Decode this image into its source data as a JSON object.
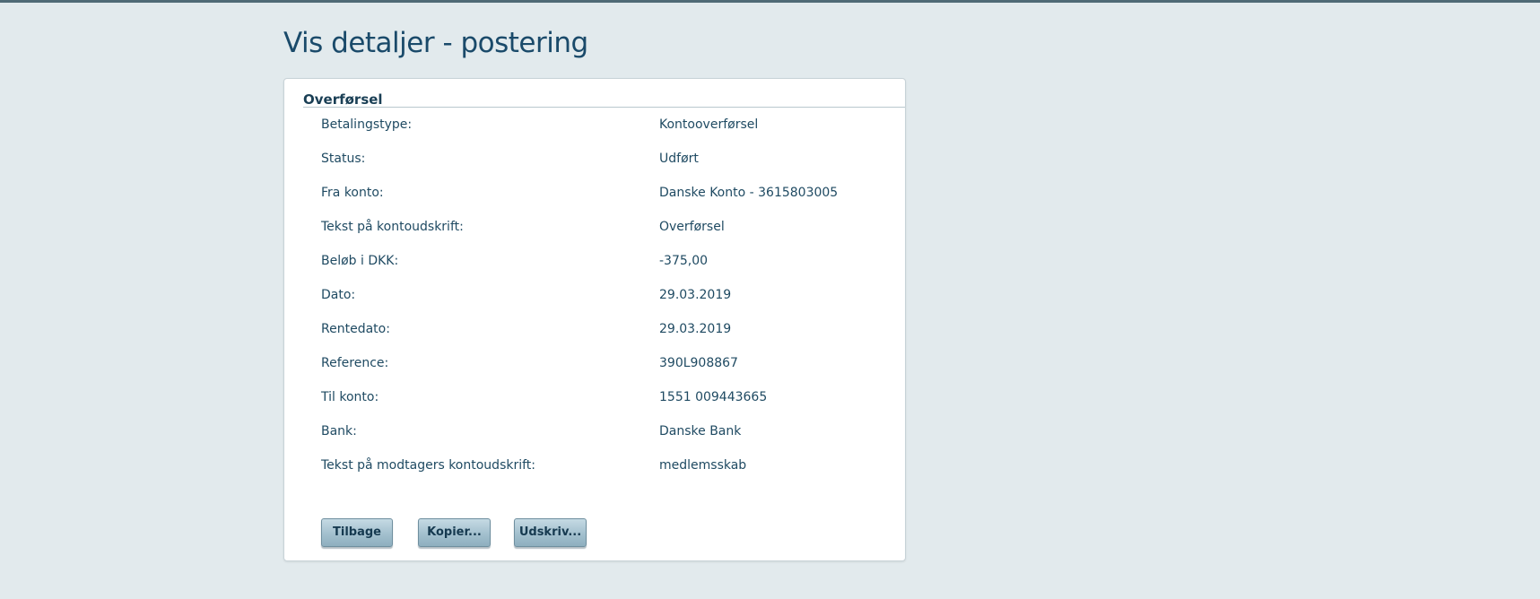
{
  "page": {
    "title": "Vis detaljer - postering"
  },
  "panel": {
    "header": "Overførsel",
    "rows": [
      {
        "label": "Betalingstype:",
        "value": "Kontooverførsel"
      },
      {
        "label": "Status:",
        "value": "Udført"
      },
      {
        "label": "Fra konto:",
        "value": "Danske Konto - 3615803005"
      },
      {
        "label": "Tekst på kontoudskrift:",
        "value": "Overførsel"
      },
      {
        "label": "Beløb i DKK:",
        "value": "-375,00"
      },
      {
        "label": "Dato:",
        "value": "29.03.2019"
      },
      {
        "label": "Rentedato:",
        "value": "29.03.2019"
      },
      {
        "label": "Reference:",
        "value": "390L908867"
      },
      {
        "label": "Til konto:",
        "value": "1551 009443665"
      },
      {
        "label": "Bank:",
        "value": "Danske Bank"
      },
      {
        "label": "Tekst på modtagers kontoudskrift:",
        "value": "medlemsskab"
      }
    ]
  },
  "buttons": {
    "back": "Tilbage",
    "copy": "Kopier...",
    "print": "Udskriv..."
  },
  "colors": {
    "background": "#e2eaed",
    "text": "#1a3f55",
    "button_gradient_top": "#c5dae4",
    "button_gradient_bottom": "#8eafbf"
  }
}
